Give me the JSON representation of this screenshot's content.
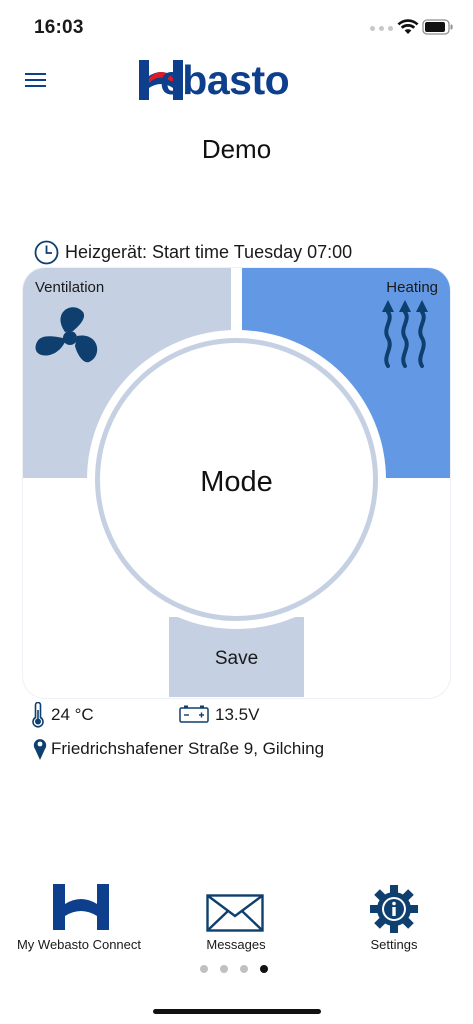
{
  "status_bar": {
    "time": "16:03"
  },
  "header": {
    "logo_text": "Webasto",
    "device_name": "Demo"
  },
  "schedule": {
    "text": "Heizgerät: Start time Tuesday 07:00"
  },
  "modes": {
    "ventilation_label": "Ventilation",
    "heating_label": "Heating",
    "center_label": "Mode",
    "save_label": "Save",
    "colors": {
      "ventilation": "#c5d1e3",
      "heating": "#6399e4",
      "icon": "#0e3f6e"
    }
  },
  "info": {
    "temperature": "24 °C",
    "voltage": "13.5V",
    "address": "Friedrichshafener Straße 9, Gilching"
  },
  "nav": {
    "items": [
      {
        "label": "My Webasto Connect",
        "icon": "webasto-logo-icon"
      },
      {
        "label": "Messages",
        "icon": "envelope-icon"
      },
      {
        "label": "Settings",
        "icon": "gear-info-icon"
      }
    ]
  },
  "pagination": {
    "total": 4,
    "active": 4
  },
  "brand_colors": {
    "primary": "#0e3f8c",
    "accent": "#e11b22"
  }
}
